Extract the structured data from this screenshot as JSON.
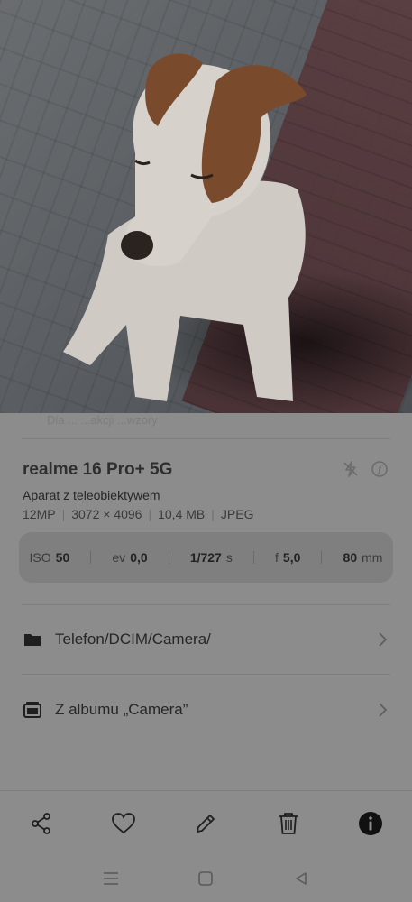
{
  "photo": {
    "subject": "dog-photo"
  },
  "info": {
    "faded_text": "Dla ... ...akcji ...wzory",
    "device_model": "realme 16 Pro+ 5G",
    "camera_type": "Aparat z teleobiektywem",
    "specs": {
      "megapixels": "12MP",
      "resolution": "3072 × 4096",
      "size": "10,4 MB",
      "format": "JPEG"
    },
    "exif": {
      "iso_label": "ISO",
      "iso_value": "50",
      "ev_label": "ev",
      "ev_value": "0,0",
      "shutter": "1/727",
      "shutter_unit": "s",
      "aperture_label": "f",
      "aperture_value": "5,0",
      "focal": "80",
      "focal_unit": "mm"
    },
    "path": "Telefon/DCIM/Camera/",
    "album": "Z albumu „Camera”"
  },
  "actions": {
    "icons": [
      "share-icon",
      "heart-icon",
      "edit-icon",
      "trash-icon",
      "info-icon"
    ]
  },
  "system_nav": {
    "icons": [
      "menu-icon",
      "home-icon",
      "back-icon"
    ]
  },
  "colors": {
    "overlay_bg": "#8c8c8c",
    "exif_bg": "#7f7f7f",
    "text_dark": "#262626"
  }
}
